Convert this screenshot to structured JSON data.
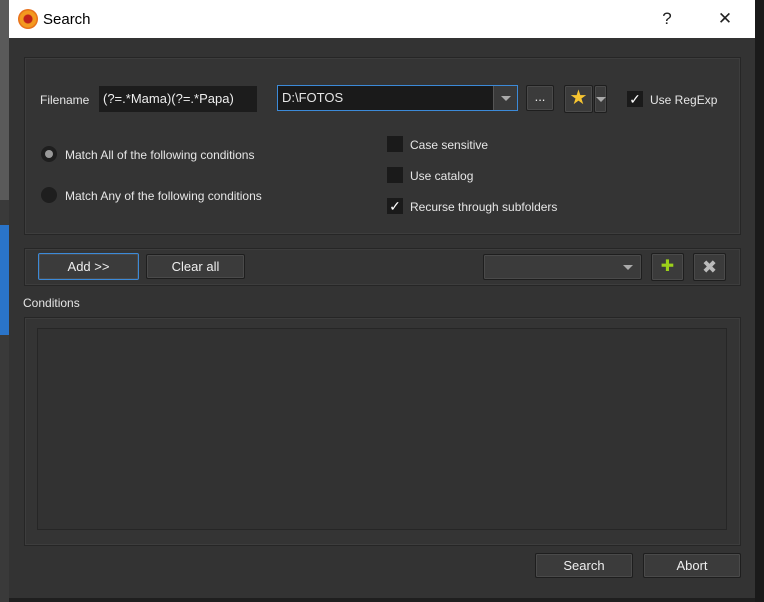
{
  "window": {
    "title": "Search",
    "help": "?",
    "close": "✕"
  },
  "filename": {
    "label": "Filename",
    "value": "(?=.*Mama)(?=.*Papa)"
  },
  "folder": {
    "value": "D:\\FOTOS",
    "browse": "..."
  },
  "use_regexp": {
    "label": "Use RegExp",
    "checked": true
  },
  "match": {
    "all": "Match All of the following conditions",
    "any": "Match Any of the following conditions"
  },
  "options": {
    "case": "Case sensitive",
    "catalog": "Use catalog",
    "recurse": "Recurse through subfolders",
    "check": "✓"
  },
  "toolbar": {
    "add": "Add >>",
    "clear": "Clear all",
    "plus": "✚",
    "remove": "✖"
  },
  "conditions": {
    "label": "Conditions"
  },
  "footer": {
    "search": "Search",
    "abort": "Abort"
  }
}
